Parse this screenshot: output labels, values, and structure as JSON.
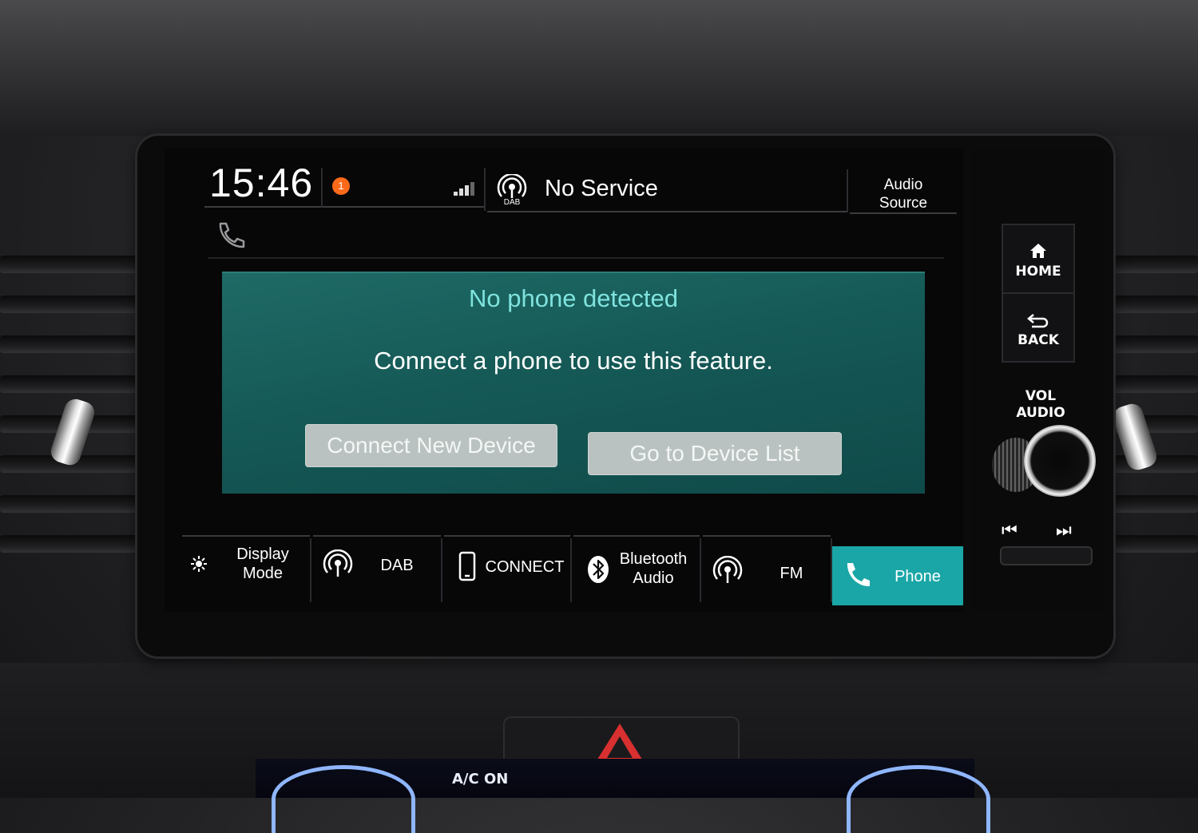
{
  "status_bar": {
    "time": "15:46",
    "notification_count": "1",
    "radio_icon": "dab-antenna-icon",
    "service_status": "No Service",
    "audio_source_line1": "Audio",
    "audio_source_line2": "Source"
  },
  "dialog": {
    "title": "No phone detected",
    "message": "Connect a phone to use this feature.",
    "connect_button": "Connect New Device",
    "device_list_button": "Go to Device List"
  },
  "source_bar": {
    "display_mode_line1": "Display",
    "display_mode_line2": "Mode",
    "dab": "DAB",
    "connect": "CONNECT",
    "bluetooth_line1": "Bluetooth",
    "bluetooth_line2": "Audio",
    "fm": "FM",
    "phone": "Phone",
    "active": "Phone",
    "active_color": "#1aa6a6"
  },
  "hardware": {
    "home": "HOME",
    "back": "BACK",
    "vol_line1": "VOL",
    "vol_line2": "AUDIO",
    "prev_symbol": "⏮",
    "next_symbol": "⏭"
  },
  "dab_icon_label": "DAB",
  "climate": {
    "ac_label": "A/C ON"
  },
  "colors": {
    "dialog_bg": "#155956",
    "dialog_title": "#7fe3de",
    "button_bg": "#b9c2c0",
    "notification_badge": "#ff6a1a",
    "hazard": "#d83030"
  }
}
